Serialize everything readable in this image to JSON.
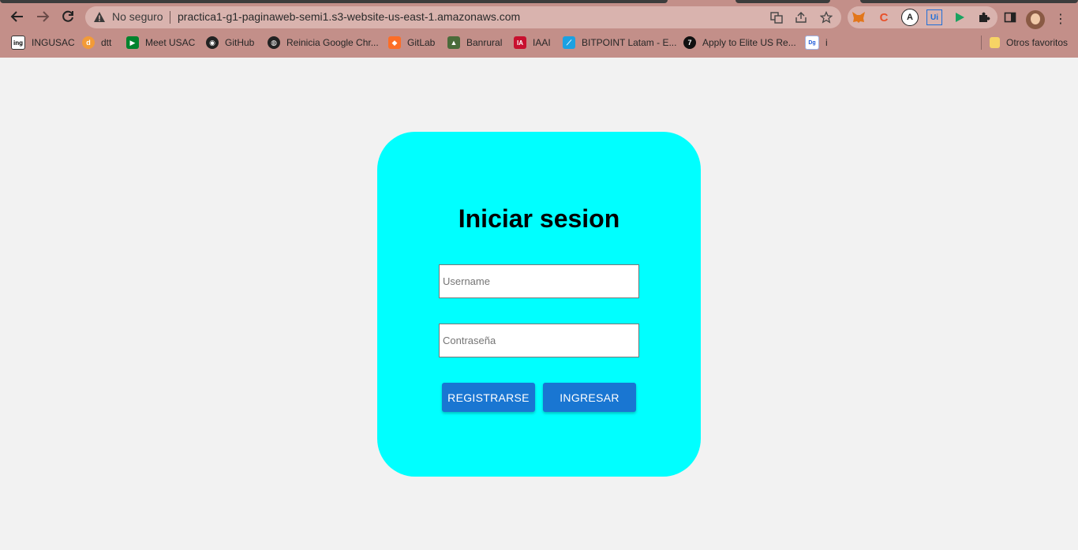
{
  "browser": {
    "security_label": "No seguro",
    "url": "practica1-g1-paginaweb-semi1.s3-website-us-east-1.amazonaws.com",
    "extensions": [
      "metamask-icon",
      "c-icon",
      "a-icon",
      "ui-icon",
      "play-icon"
    ],
    "bookmarks": [
      {
        "label": "INGUSAC",
        "icon": "ing-icon"
      },
      {
        "label": "dtt",
        "icon": "dtt-icon"
      },
      {
        "label": "Meet USAC",
        "icon": "meet-icon"
      },
      {
        "label": "GitHub",
        "icon": "github-icon"
      },
      {
        "label": "Reinicia Google Chr...",
        "icon": "globe-icon"
      },
      {
        "label": "GitLab",
        "icon": "gitlab-icon"
      },
      {
        "label": "Banrural",
        "icon": "banrural-icon"
      },
      {
        "label": "IAAI",
        "icon": "iaai-icon"
      },
      {
        "label": "BITPOINT Latam - E...",
        "icon": "bitpoint-icon"
      },
      {
        "label": "Apply to Elite US Re...",
        "icon": "seven-icon"
      },
      {
        "label": "i",
        "icon": "dg-icon"
      }
    ],
    "other_bookmarks": "Otros favoritos",
    "colors": {
      "chrome": "#c38f89",
      "omnibox": "#d9b3ae"
    }
  },
  "login": {
    "title": "Iniciar sesion",
    "username_placeholder": "Username",
    "password_placeholder": "Contraseña",
    "register_label": "REGISTRARSE",
    "login_label": "INGRESAR",
    "colors": {
      "card": "#00ffff",
      "button": "#1976d2",
      "page": "#f2f2f2"
    }
  }
}
